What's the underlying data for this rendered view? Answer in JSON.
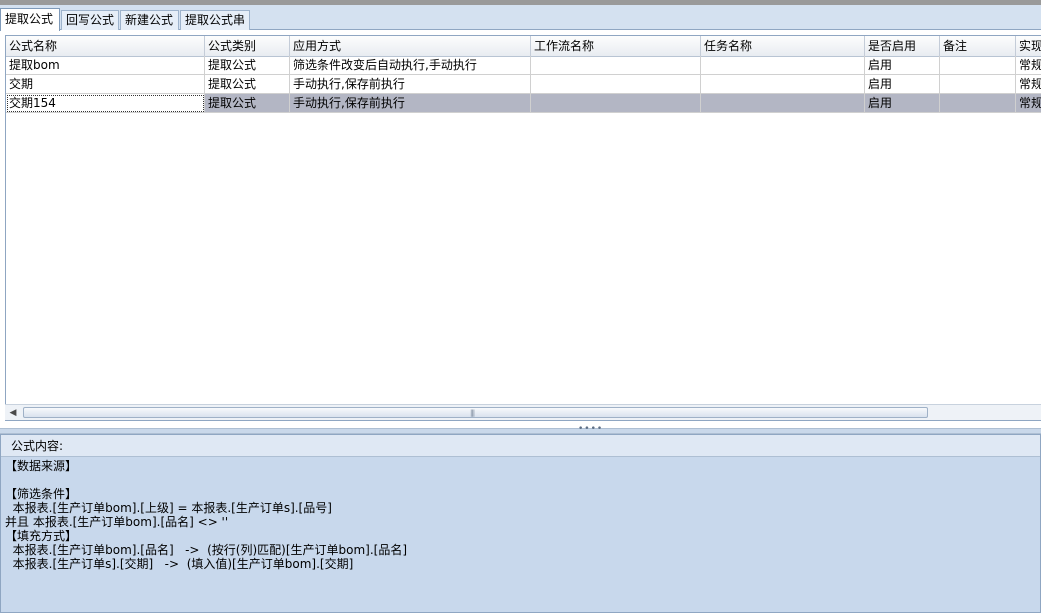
{
  "tabs": [
    "提取公式",
    "回写公式",
    "新建公式",
    "提取公式串"
  ],
  "table": {
    "columns": [
      "公式名称",
      "公式类别",
      "应用方式",
      "工作流名称",
      "任务名称",
      "是否启用",
      "备注",
      "实现"
    ],
    "rows": [
      [
        "提取bom",
        "提取公式",
        "筛选条件改变后自动执行,手动执行",
        "",
        "",
        "启用",
        "",
        "常规"
      ],
      [
        "交期",
        "提取公式",
        "手动执行,保存前执行",
        "",
        "",
        "启用",
        "",
        "常规"
      ],
      [
        "交期154",
        "提取公式",
        "手动执行,保存前执行",
        "",
        "",
        "启用",
        "",
        "常规"
      ]
    ],
    "selected_row": 3
  },
  "scrollbar": {
    "grip": "|||"
  },
  "panel": {
    "title": "公式内容:",
    "lines": [
      "【数据来源】",
      "",
      "【筛选条件】",
      "  本报表.[生产订单bom].[上级] = 本报表.[生产订单s].[品号]",
      "并且 本报表.[生产订单bom].[品名] <> ''",
      "【填充方式】",
      "  本报表.[生产订单bom].[品名]   ->  (按行(列)匹配)[生产订单bom].[品名]",
      "  本报表.[生产订单s].[交期]   ->  (填入值)[生产订单bom].[交期]"
    ]
  }
}
